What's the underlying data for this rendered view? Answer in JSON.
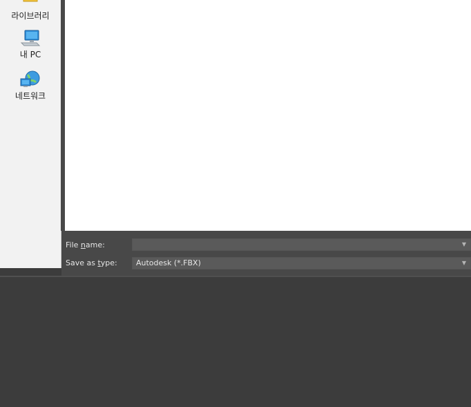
{
  "sidebar": {
    "items": [
      {
        "label": "라이브러리",
        "icon": "library-icon"
      },
      {
        "label": "내 PC",
        "icon": "computer-icon"
      },
      {
        "label": "네트워크",
        "icon": "network-icon"
      }
    ]
  },
  "save_panel": {
    "file_name_label_pre": "File ",
    "file_name_label_u": "n",
    "file_name_label_post": "ame:",
    "file_name_value": "",
    "save_type_label_pre": "Save as ",
    "save_type_label_u": "t",
    "save_type_label_post": "ype:",
    "save_type_value": "Autodesk (*.FBX)",
    "dropdown_arrow": "▼"
  },
  "colors": {
    "background": "#3c3c3c",
    "panel": "#484848",
    "combo": "#5a5a5a",
    "sidebar": "#f2f2f2"
  }
}
